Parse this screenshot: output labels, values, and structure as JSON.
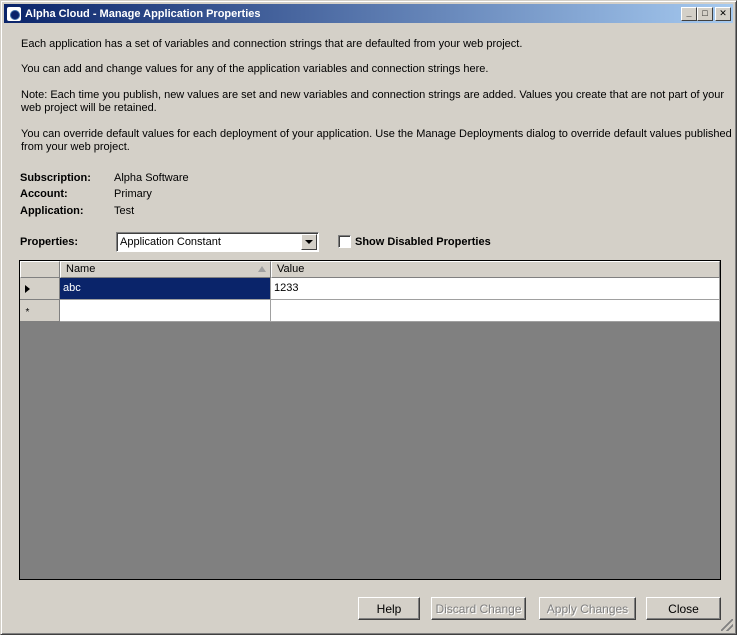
{
  "window": {
    "title": "Alpha Cloud - Manage Application Properties",
    "minimize_glyph": "_",
    "maximize_glyph": "□",
    "close_glyph": "✕"
  },
  "intro": {
    "p1": "Each application has a set of variables and connection strings that are defaulted from your web project.",
    "p2": "You can add and change values for any of the application variables and connection strings here.",
    "p3_line1": "Note: Each time you publish, new values are set and new variables and connection strings are added. Values you create that are not part of your",
    "p3_line2": "web project will be retained.",
    "p4_line1": "You can override default values for each deployment of your application.  Use the Manage Deployments dialog to override default values published",
    "p4_line2": "from your web project."
  },
  "info": {
    "subscription_label": "Subscription:",
    "subscription_value": "Alpha Software",
    "account_label": "Account:",
    "account_value": "Primary",
    "application_label": "Application:",
    "application_value": "Test"
  },
  "properties": {
    "label": "Properties:",
    "selected": "Application Constant",
    "show_disabled_label": "Show Disabled Properties",
    "show_disabled_checked": false
  },
  "grid": {
    "columns": [
      "Name",
      "Value"
    ],
    "rows": [
      {
        "name": "abc",
        "value": "1233"
      }
    ],
    "new_row_marker": "*"
  },
  "buttons": {
    "help": "Help",
    "discard": "Discard Change",
    "apply": "Apply Changes",
    "close": "Close"
  }
}
